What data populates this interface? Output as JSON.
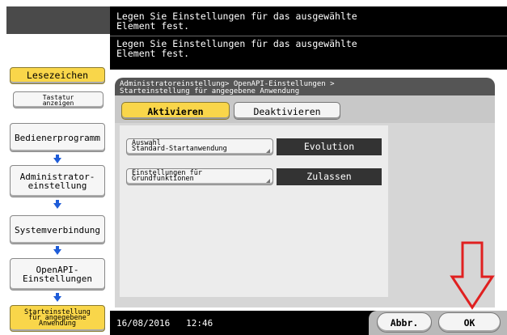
{
  "messages": {
    "line1": "Legen Sie Einstellungen für das ausgewählte\nElement fest.",
    "line2": "Legen Sie Einstellungen für das ausgewählte\nElement fest."
  },
  "sidebar": {
    "bookmark": "Lesezeichen",
    "keyboard": "Tastatur\nanzeigen",
    "items": [
      {
        "label": "Bedienerprogramm"
      },
      {
        "label": "Administrator-\neinstellung"
      },
      {
        "label": "Systemverbindung"
      },
      {
        "label": "OpenAPI-\nEinstellungen"
      },
      {
        "label": "Starteinstellung\nfür angegebene\nAnwendung"
      }
    ]
  },
  "breadcrumb": "Administratoreinstellung> OpenAPI-Einstellungen >\nStarteinstellung für angegebene Anwendung",
  "tabs": {
    "activate": "Aktivieren",
    "deactivate": "Deaktivieren"
  },
  "settings": [
    {
      "label": "Auswahl\nStandard-Startanwendung",
      "value": "Evolution"
    },
    {
      "label": "Einstellungen für\nGrundfunktionen",
      "value": "Zulassen"
    }
  ],
  "status": {
    "date": "16/08/2016",
    "time": "12:46"
  },
  "footer": {
    "cancel": "Abbr.",
    "ok": "OK"
  },
  "colors": {
    "accent_yellow": "#f9d64a",
    "arrow_blue": "#1e5cd8",
    "highlight_red": "#e02020"
  }
}
